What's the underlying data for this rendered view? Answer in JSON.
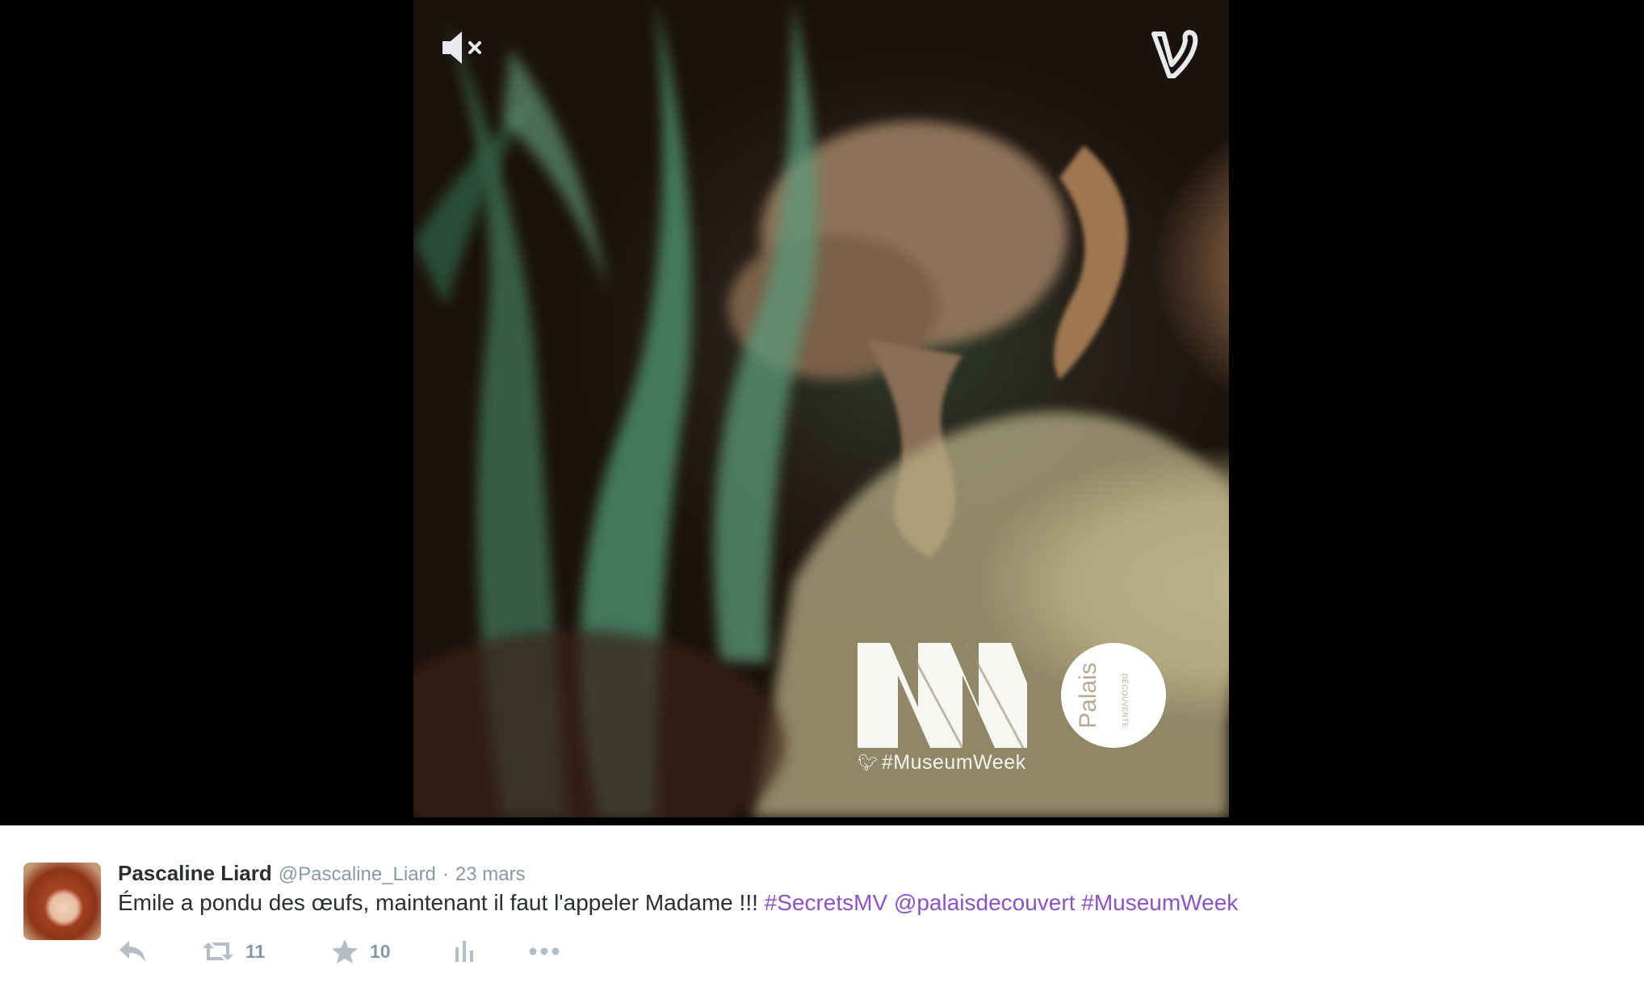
{
  "video": {
    "mute_icon": "volume-muted-icon",
    "provider_logo": "vine-logo-icon",
    "watermark_tag": "#MuseumWeek",
    "partner_logo_text": "Palais",
    "partner_logo_subtext": "DÉCOUVERTE"
  },
  "tweet": {
    "display_name": "Pascaline Liard",
    "username": "@Pascaline_Liard",
    "separator": "·",
    "date": "23 mars",
    "text_plain": "Émile a pondu des œufs, maintenant il faut l'appeler Madame !!! ",
    "hashtag_1": "#SecretsMV",
    "mention": "@palaisdecouvert",
    "hashtag_2": "#MuseumWeek",
    "actions": {
      "reply_icon": "reply-icon",
      "retweet_icon": "retweet-icon",
      "retweet_count": "11",
      "favorite_icon": "star-icon",
      "favorite_count": "10",
      "analytics_icon": "analytics-icon",
      "more_icon": "more-icon"
    }
  },
  "colors": {
    "link": "#8d52c7",
    "muted": "#8899a6",
    "text": "#292f33",
    "player_bg": "#000000"
  }
}
